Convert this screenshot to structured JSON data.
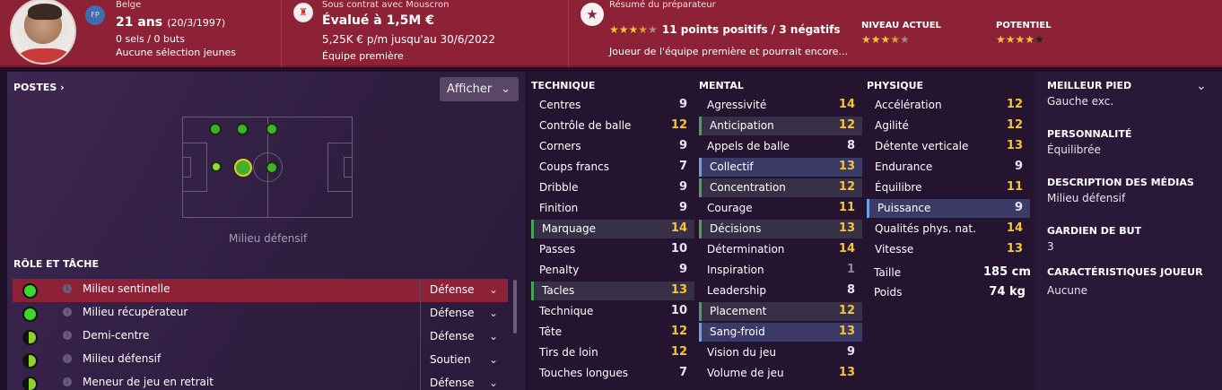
{
  "header": {
    "nationality": "Belge",
    "position_badge": "FP",
    "age": "21 ans",
    "dob": "(20/3/1997)",
    "caps": "0 sels / 0 buts",
    "youth": "Aucune sélection jeunes",
    "contract_label": "Sous contrat avec Mouscron",
    "value": "Évalué à 1,5M €",
    "wage": "5,25K € p/m jusqu'au 30/6/2022",
    "squad": "Équipe première",
    "report_label": "Résumé du préparateur",
    "report_points": "11 points positifs / 3 négatifs",
    "report_summary": "Joueur de l'équipe première et pourrait encore...",
    "current_ability_label": "NIVEAU ACTUEL",
    "potential_label": "POTENTIEL",
    "report_stars": 3.5,
    "current_ability_stars": 3.5,
    "potential_stars": 4
  },
  "positions": {
    "title": "POSTES ›",
    "afficher": "Afficher",
    "caption": "Milieu défensif"
  },
  "roles": {
    "title": "RÔLE ET TÂCHE",
    "rows": [
      {
        "name": "Milieu sentinelle",
        "duty": "Défense"
      },
      {
        "name": "Milieu récupérateur",
        "duty": "Défense"
      },
      {
        "name": "Demi-centre",
        "duty": "Défense"
      },
      {
        "name": "Milieu défensif",
        "duty": "Soutien"
      },
      {
        "name": "Meneur de jeu en retrait",
        "duty": "Défense"
      }
    ]
  },
  "technique": {
    "title": "TECHNIQUE",
    "rows": [
      {
        "label": "Centres",
        "value": "9"
      },
      {
        "label": "Contrôle de balle",
        "value": "12"
      },
      {
        "label": "Corners",
        "value": "9"
      },
      {
        "label": "Coups francs",
        "value": "7"
      },
      {
        "label": "Dribble",
        "value": "9"
      },
      {
        "label": "Finition",
        "value": "9"
      },
      {
        "label": "Marquage",
        "value": "14"
      },
      {
        "label": "Passes",
        "value": "10"
      },
      {
        "label": "Penalty",
        "value": "9"
      },
      {
        "label": "Tacles",
        "value": "13"
      },
      {
        "label": "Technique",
        "value": "10"
      },
      {
        "label": "Tête",
        "value": "12"
      },
      {
        "label": "Tirs de loin",
        "value": "12"
      },
      {
        "label": "Touches longues",
        "value": "7"
      }
    ]
  },
  "mental": {
    "title": "MENTAL",
    "rows": [
      {
        "label": "Agressivité",
        "value": "14"
      },
      {
        "label": "Anticipation",
        "value": "12"
      },
      {
        "label": "Appels de balle",
        "value": "8"
      },
      {
        "label": "Collectif",
        "value": "13"
      },
      {
        "label": "Concentration",
        "value": "12"
      },
      {
        "label": "Courage",
        "value": "11"
      },
      {
        "label": "Décisions",
        "value": "13"
      },
      {
        "label": "Détermination",
        "value": "14"
      },
      {
        "label": "Inspiration",
        "value": "1"
      },
      {
        "label": "Leadership",
        "value": "8"
      },
      {
        "label": "Placement",
        "value": "12"
      },
      {
        "label": "Sang-froid",
        "value": "13"
      },
      {
        "label": "Vision du jeu",
        "value": "9"
      },
      {
        "label": "Volume de jeu",
        "value": "13"
      }
    ]
  },
  "physique": {
    "title": "PHYSIQUE",
    "rows": [
      {
        "label": "Accélération",
        "value": "12"
      },
      {
        "label": "Agilité",
        "value": "12"
      },
      {
        "label": "Détente verticale",
        "value": "13"
      },
      {
        "label": "Endurance",
        "value": "9"
      },
      {
        "label": "Équilibre",
        "value": "11"
      },
      {
        "label": "Puissance",
        "value": "9"
      },
      {
        "label": "Qualités phys. nat.",
        "value": "14"
      },
      {
        "label": "Vitesse",
        "value": "13"
      }
    ],
    "height_label": "Taille",
    "height": "185 cm",
    "weight_label": "Poids",
    "weight": "74 kg"
  },
  "side": {
    "foot_label": "MEILLEUR PIED",
    "foot": "Gauche exc.",
    "personality_label": "PERSONNALITÉ",
    "personality": "Équilibrée",
    "media_label": "DESCRIPTION DES MÉDIAS",
    "media": "Milieu défensif",
    "gk_label": "GARDIEN DE BUT",
    "gk": "3",
    "traits_label": "CARACTÉRISTIQUES JOUEUR",
    "traits": "Aucune"
  },
  "colors": {
    "header": "#8d2236",
    "accent_gold": "#f7c531",
    "green": "#43b12e"
  }
}
